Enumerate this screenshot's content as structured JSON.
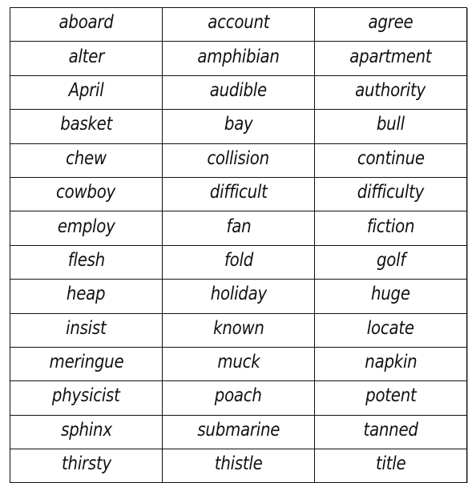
{
  "word_table": {
    "rows": [
      [
        "aboard",
        "account",
        "agree"
      ],
      [
        "alter",
        "amphibian",
        "apartment"
      ],
      [
        "April",
        "audible",
        "authority"
      ],
      [
        "basket",
        "bay",
        "bull"
      ],
      [
        "chew",
        "collision",
        "continue"
      ],
      [
        "cowboy",
        "difficult",
        "difficulty"
      ],
      [
        "employ",
        "fan",
        "fiction"
      ],
      [
        "flesh",
        "fold",
        "golf"
      ],
      [
        "heap",
        "holiday",
        "huge"
      ],
      [
        "insist",
        "known",
        "locate"
      ],
      [
        "meringue",
        "muck",
        "napkin"
      ],
      [
        "physicist",
        "poach",
        "potent"
      ],
      [
        "sphinx",
        "submarine",
        "tanned"
      ],
      [
        "thirsty",
        "thistle",
        "title"
      ]
    ]
  }
}
